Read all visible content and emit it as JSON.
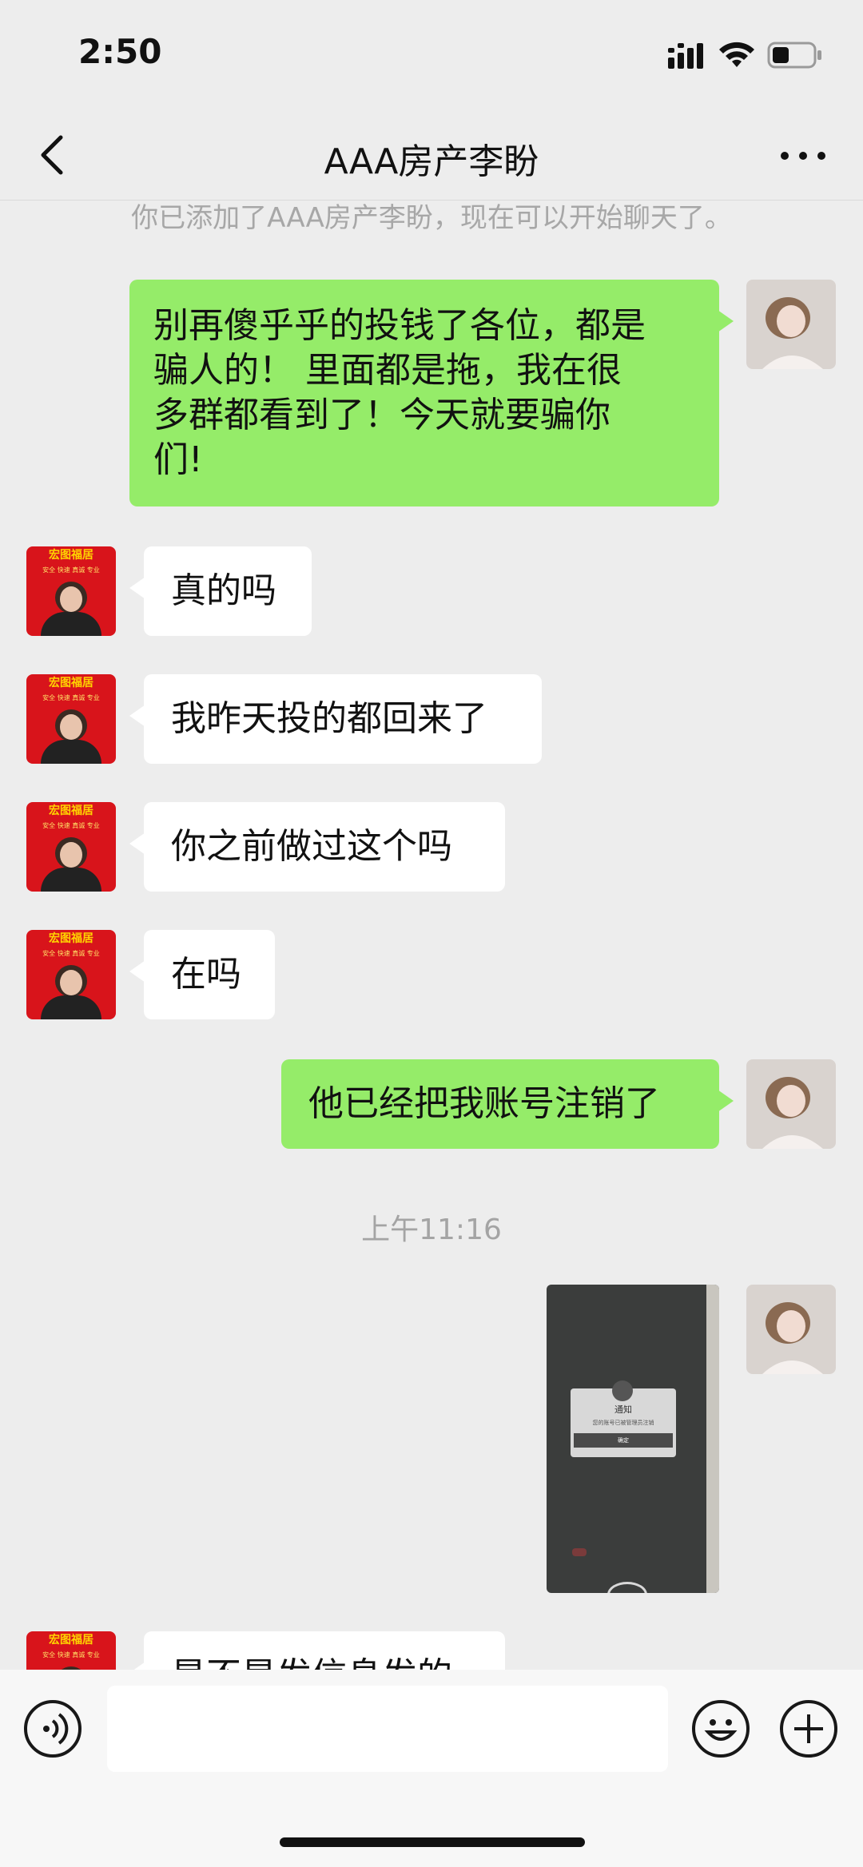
{
  "status_bar": {
    "time": "2:50"
  },
  "header": {
    "title": "AAA房产李盼"
  },
  "system_note": "你已添加了AAA房产李盼，现在可以开始聊天了。",
  "messages": [
    {
      "side": "right",
      "lines": [
        "别再傻乎乎的投钱了各位，都是",
        "骗人的！ 里面都是拖，我在很",
        "多群都看到了！今天就要骗你",
        "们!"
      ]
    },
    {
      "side": "left",
      "text": "真的吗"
    },
    {
      "side": "left",
      "text": "我昨天投的都回来了"
    },
    {
      "side": "left",
      "text": "你之前做过这个吗"
    },
    {
      "side": "left",
      "text": "在吗"
    },
    {
      "side": "right",
      "text": "他已经把我账号注销了"
    }
  ],
  "timestamp": "上午11:16",
  "photo": {
    "dialog_title": "通知",
    "dialog_body": "您的账号已被管理员注销",
    "dialog_button": "确定"
  },
  "partial_message": "是不是发信息发的",
  "avatar_banner": {
    "top": "宏图福居",
    "slogan": "安全 快速 真诚 专业"
  },
  "colors": {
    "sent_bubble": "#95ec69",
    "received_bubble": "#ffffff",
    "background": "#ededed",
    "agent_avatar": "#d8141b"
  }
}
